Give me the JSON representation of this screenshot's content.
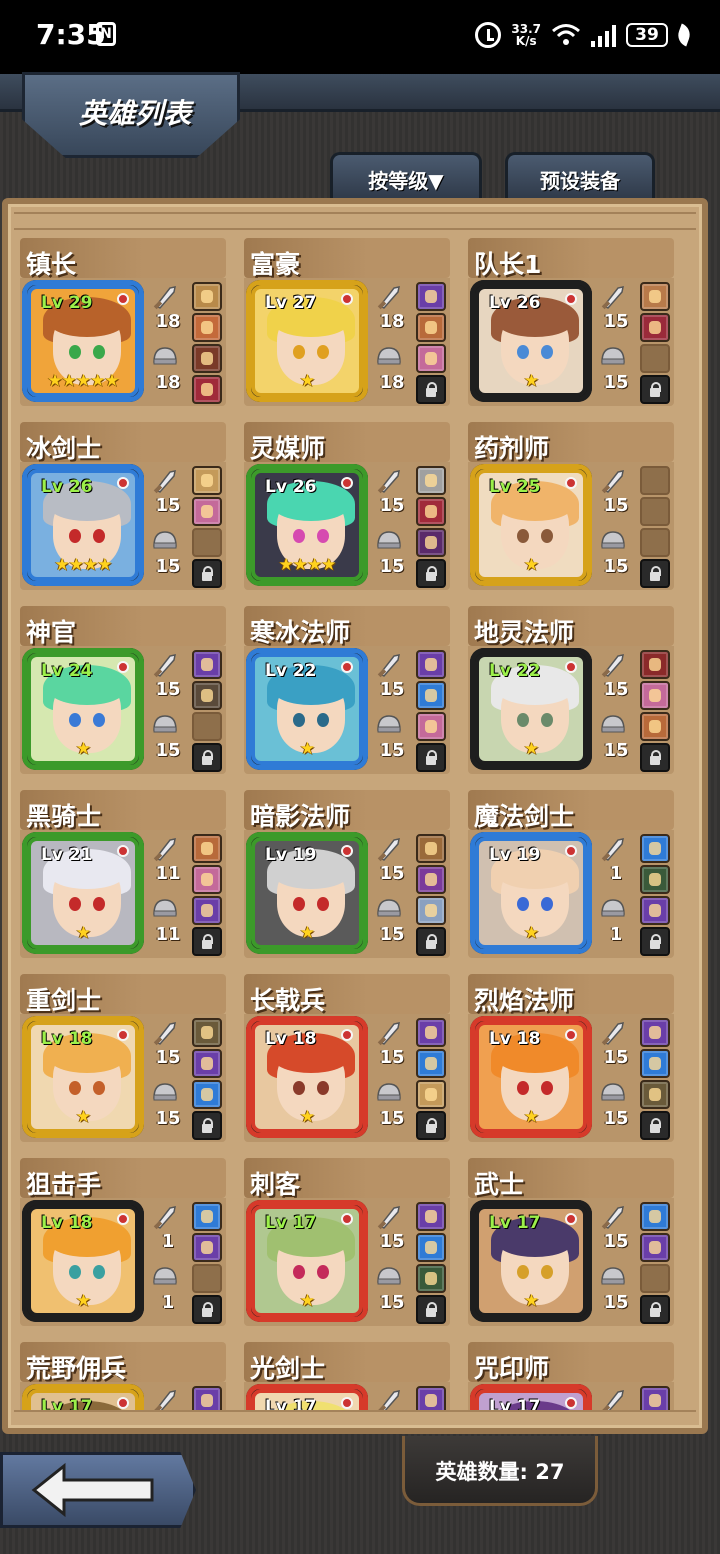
{
  "status_bar": {
    "time": "7:35",
    "nfc": "N",
    "speed_value": "33.7",
    "speed_unit": "K/s",
    "battery": "39"
  },
  "header": {
    "title": "英雄列表",
    "sort_button": "按等级▼",
    "preset_button": "预设装备"
  },
  "heroes": [
    {
      "name": "镇长",
      "level": "Lv 29",
      "level_color": "#9cf04a",
      "frame": "#2f7bd6",
      "bg": "#f0a43a",
      "hair": "#b8622a",
      "eye": "#3aa84a",
      "stars": "★★★★★",
      "atk": "18",
      "def": "18",
      "slots": [
        "item:#b88a4a",
        "item:#c46a3a",
        "item:#7a3a28",
        "item:#a02a3a"
      ]
    },
    {
      "name": "富豪",
      "level": "Lv 27",
      "level_color": "#ffffff",
      "frame": "#d6a21a",
      "bg": "#f3d36a",
      "hair": "#f0d24a",
      "eye": "#e0a020",
      "stars": "★",
      "atk": "18",
      "def": "18",
      "slots": [
        "item:#6a3ea8",
        "item:#b86a3a",
        "item:#c46a9a",
        "locked"
      ]
    },
    {
      "name": "队长1",
      "level": "Lv 26",
      "level_color": "#ffffff",
      "frame": "#1e1e1e",
      "bg": "#e7d6c0",
      "hair": "#9a5a3a",
      "eye": "#4a8ad6",
      "stars": "★",
      "atk": "15",
      "def": "15",
      "slots": [
        "item:#b87a4a",
        "item:#9a2a3a",
        "empty",
        "locked"
      ]
    },
    {
      "name": "冰剑士",
      "level": "Lv 26",
      "level_color": "#9cf04a",
      "frame": "#2f7bd6",
      "bg": "#7ab0e0",
      "hair": "#b8bcc4",
      "eye": "#c42a2a",
      "stars": "★★★★",
      "atk": "15",
      "def": "15",
      "slots": [
        "item:#c49a5a",
        "item:#c46a9a",
        "empty",
        "locked"
      ]
    },
    {
      "name": "灵媒师",
      "level": "Lv 26",
      "level_color": "#ffffff",
      "frame": "#3c9a2a",
      "bg": "#3a3a4a",
      "hair": "#4ad6b0",
      "eye": "#d64ab0",
      "stars": "★★★★",
      "atk": "15",
      "def": "15",
      "slots": [
        "item:#a0a0a0",
        "item:#a02a3a",
        "item:#5a2a6a",
        "locked"
      ]
    },
    {
      "name": "药剂师",
      "level": "Lv 25",
      "level_color": "#9cf04a",
      "frame": "#d6a21a",
      "bg": "#f0dcc0",
      "hair": "#f0b46a",
      "eye": "#8a5a3a",
      "stars": "★",
      "atk": "15",
      "def": "15",
      "slots": [
        "empty",
        "empty",
        "empty",
        "locked"
      ]
    },
    {
      "name": "神官",
      "level": "Lv 24",
      "level_color": "#9cf04a",
      "frame": "#3c9a2a",
      "bg": "#d6e8b0",
      "hair": "#5ad6a0",
      "eye": "#3a7ad6",
      "stars": "★",
      "atk": "15",
      "def": "15",
      "slots": [
        "item:#6a3ea8",
        "item:#5a4a3a",
        "empty",
        "locked"
      ]
    },
    {
      "name": "寒冰法师",
      "level": "Lv 22",
      "level_color": "#ffffff",
      "frame": "#2f7bd6",
      "bg": "#6ac0d6",
      "hair": "#3aa0c4",
      "eye": "#2a6a8a",
      "stars": "★",
      "atk": "15",
      "def": "15",
      "slots": [
        "item:#6a3ea8",
        "item:#2f7bd6",
        "item:#c46a9a",
        "locked"
      ]
    },
    {
      "name": "地灵法师",
      "level": "Lv 22",
      "level_color": "#9cf04a",
      "frame": "#1e1e1e",
      "bg": "#c8d6b0",
      "hair": "#e8e8e8",
      "eye": "#6a8a6a",
      "stars": "★",
      "atk": "15",
      "def": "15",
      "slots": [
        "item:#8a2a2a",
        "item:#c46a9a",
        "item:#b86a3a",
        "locked"
      ]
    },
    {
      "name": "黑骑士",
      "level": "Lv 21",
      "level_color": "#ffffff",
      "frame": "#3c9a2a",
      "bg": "#b8b8c0",
      "hair": "#e8e8f0",
      "eye": "#c42a2a",
      "stars": "★",
      "atk": "11",
      "def": "11",
      "slots": [
        "item:#b86a3a",
        "item:#c46a9a",
        "item:#6a3ea8",
        "locked"
      ]
    },
    {
      "name": "暗影法师",
      "level": "Lv 19",
      "level_color": "#ffffff",
      "frame": "#3c9a2a",
      "bg": "#5a5a5a",
      "hair": "#d0d0d0",
      "eye": "#c42a2a",
      "stars": "★",
      "atk": "15",
      "def": "15",
      "slots": [
        "item:#9a6a3a",
        "item:#7a3a9a",
        "item:#8aa0c0",
        "locked"
      ]
    },
    {
      "name": "魔法剑士",
      "level": "Lv 19",
      "level_color": "#ffffff",
      "frame": "#2f7bd6",
      "bg": "#d0c0b0",
      "hair": "#f0d0b0",
      "eye": "#3a6ad6",
      "stars": "★",
      "atk": "1",
      "def": "1",
      "slots": [
        "item:#2f7bd6",
        "item:#3a5a3a",
        "item:#6a3ea8",
        "locked"
      ]
    },
    {
      "name": "重剑士",
      "level": "Lv 18",
      "level_color": "#9cf04a",
      "frame": "#d6a21a",
      "bg": "#f0d8b0",
      "hair": "#f0b050",
      "eye": "#c4602a",
      "stars": "★",
      "atk": "15",
      "def": "15",
      "slots": [
        "item:#6a5a3a",
        "item:#6a3ea8",
        "item:#2f7bd6",
        "locked"
      ]
    },
    {
      "name": "长戟兵",
      "level": "Lv 18",
      "level_color": "#ffffff",
      "frame": "#d63a2a",
      "bg": "#e8c8a0",
      "hair": "#d64a2a",
      "eye": "#8a3a2a",
      "stars": "★",
      "atk": "15",
      "def": "15",
      "slots": [
        "item:#6a3ea8",
        "item:#2f7bd6",
        "item:#c49a5a",
        "locked"
      ]
    },
    {
      "name": "烈焰法师",
      "level": "Lv 18",
      "level_color": "#ffffff",
      "frame": "#d63a2a",
      "bg": "#f0a050",
      "hair": "#f08a2a",
      "eye": "#c42a2a",
      "stars": "★",
      "atk": "15",
      "def": "15",
      "slots": [
        "item:#6a3ea8",
        "item:#2f7bd6",
        "item:#6a5a3a",
        "locked"
      ]
    },
    {
      "name": "狙击手",
      "level": "Lv 18",
      "level_color": "#9cf04a",
      "frame": "#1e1e1e",
      "bg": "#f0c070",
      "hair": "#f0a030",
      "eye": "#3aa0a0",
      "stars": "★",
      "atk": "1",
      "def": "1",
      "slots": [
        "item:#2f7bd6",
        "item:#6a3ea8",
        "empty",
        "locked"
      ]
    },
    {
      "name": "刺客",
      "level": "Lv 17",
      "level_color": "#9cf04a",
      "frame": "#d63a2a",
      "bg": "#b0c890",
      "hair": "#a0c070",
      "eye": "#c42a5a",
      "stars": "★",
      "atk": "15",
      "def": "15",
      "slots": [
        "item:#6a3ea8",
        "item:#2f7bd6",
        "item:#3a5a3a",
        "locked"
      ]
    },
    {
      "name": "武士",
      "level": "Lv 17",
      "level_color": "#9cf04a",
      "frame": "#1e1e1e",
      "bg": "#d0a070",
      "hair": "#4a3a6a",
      "eye": "#d6a02a",
      "stars": "★",
      "atk": "15",
      "def": "15",
      "slots": [
        "item:#2f7bd6",
        "item:#6a3ea8",
        "empty",
        "locked"
      ]
    },
    {
      "name": "荒野佣兵",
      "level": "Lv 17",
      "level_color": "#9cf04a",
      "frame": "#d6a21a",
      "bg": "#e0c090",
      "hair": "#8a6a3a",
      "eye": "#3a6a3a",
      "stars": "★",
      "atk": "",
      "def": "",
      "slots": [
        "item:#6a3ea8",
        "empty",
        "empty",
        "locked"
      ]
    },
    {
      "name": "光剑士",
      "level": "Lv 17",
      "level_color": "#ffffff",
      "frame": "#d63a2a",
      "bg": "#f0d8b0",
      "hair": "#f0e070",
      "eye": "#3a6ad6",
      "stars": "★",
      "atk": "",
      "def": "",
      "slots": [
        "item:#6a3ea8",
        "empty",
        "empty",
        "locked"
      ]
    },
    {
      "name": "咒印师",
      "level": "Lv 17",
      "level_color": "#ffffff",
      "frame": "#d63a2a",
      "bg": "#c0a0d0",
      "hair": "#6a3a8a",
      "eye": "#c42a2a",
      "stars": "★",
      "atk": "",
      "def": "",
      "slots": [
        "item:#6a3ea8",
        "empty",
        "empty",
        "locked"
      ]
    }
  ],
  "footer": {
    "hero_count": "英雄数量: 27"
  }
}
